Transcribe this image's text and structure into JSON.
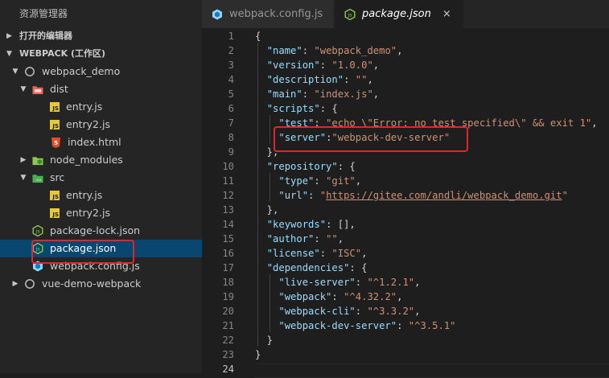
{
  "sidebar": {
    "title": "资源管理器",
    "sections": [
      {
        "label": "打开的编辑器",
        "expanded": false
      },
      {
        "label": "WEBPACK (工作区)",
        "expanded": true
      }
    ],
    "tree": [
      {
        "label": "webpack_demo",
        "kind": "root",
        "expanded": true,
        "depth": 1
      },
      {
        "label": "dist",
        "kind": "folder-dist",
        "expanded": true,
        "depth": 2
      },
      {
        "label": "entry.js",
        "kind": "js",
        "depth": 3
      },
      {
        "label": "entry2.js",
        "kind": "js",
        "depth": 3
      },
      {
        "label": "index.html",
        "kind": "html",
        "depth": 3
      },
      {
        "label": "node_modules",
        "kind": "folder-node",
        "expanded": false,
        "depth": 2
      },
      {
        "label": "src",
        "kind": "folder-src",
        "expanded": true,
        "depth": 2
      },
      {
        "label": "entry.js",
        "kind": "js",
        "depth": 3
      },
      {
        "label": "entry2.js",
        "kind": "js",
        "depth": 3
      },
      {
        "label": "package-lock.json",
        "kind": "node",
        "depth": 2
      },
      {
        "label": "package.json",
        "kind": "node",
        "depth": 2,
        "selected": true
      },
      {
        "label": "webpack.config.js",
        "kind": "webpack",
        "depth": 2
      },
      {
        "label": "vue-demo-webpack",
        "kind": "root",
        "expanded": false,
        "depth": 1
      }
    ]
  },
  "tabs": [
    {
      "label": "webpack.config.js",
      "active": false
    },
    {
      "label": "package.json",
      "active": true,
      "close": "×"
    }
  ],
  "js_badge": "JS",
  "editor": {
    "lines": [
      {
        "n": "1",
        "tokens": [
          [
            "punc",
            "{"
          ]
        ]
      },
      {
        "n": "2",
        "tokens": [
          [
            "punc",
            "  "
          ],
          [
            "key",
            "\"name\""
          ],
          [
            "punc",
            ": "
          ],
          [
            "str",
            "\"webpack_demo\""
          ],
          [
            "punc",
            ","
          ]
        ]
      },
      {
        "n": "3",
        "tokens": [
          [
            "punc",
            "  "
          ],
          [
            "key",
            "\"version\""
          ],
          [
            "punc",
            ": "
          ],
          [
            "str",
            "\"1.0.0\""
          ],
          [
            "punc",
            ","
          ]
        ]
      },
      {
        "n": "4",
        "tokens": [
          [
            "punc",
            "  "
          ],
          [
            "key",
            "\"description\""
          ],
          [
            "punc",
            ": "
          ],
          [
            "str",
            "\"\""
          ],
          [
            "punc",
            ","
          ]
        ]
      },
      {
        "n": "5",
        "tokens": [
          [
            "punc",
            "  "
          ],
          [
            "key",
            "\"main\""
          ],
          [
            "punc",
            ": "
          ],
          [
            "str",
            "\"index.js\""
          ],
          [
            "punc",
            ","
          ]
        ]
      },
      {
        "n": "6",
        "tokens": [
          [
            "punc",
            "  "
          ],
          [
            "key",
            "\"scripts\""
          ],
          [
            "punc",
            ": {"
          ]
        ]
      },
      {
        "n": "7",
        "tokens": [
          [
            "punc",
            "    "
          ],
          [
            "key",
            "\"test\""
          ],
          [
            "punc",
            ": "
          ],
          [
            "str",
            "\"echo \\\"Error: no test specified\\\" && exit 1\""
          ],
          [
            "punc",
            ","
          ]
        ]
      },
      {
        "n": "8",
        "tokens": [
          [
            "punc",
            "    "
          ],
          [
            "key",
            "\"server\""
          ],
          [
            "punc",
            ":"
          ],
          [
            "str",
            "\"webpack-dev-server\""
          ]
        ]
      },
      {
        "n": "9",
        "tokens": [
          [
            "punc",
            "  },"
          ]
        ]
      },
      {
        "n": "10",
        "tokens": [
          [
            "punc",
            "  "
          ],
          [
            "key",
            "\"repository\""
          ],
          [
            "punc",
            ": {"
          ]
        ]
      },
      {
        "n": "11",
        "tokens": [
          [
            "punc",
            "    "
          ],
          [
            "key",
            "\"type\""
          ],
          [
            "punc",
            ": "
          ],
          [
            "str",
            "\"git\""
          ],
          [
            "punc",
            ","
          ]
        ]
      },
      {
        "n": "12",
        "tokens": [
          [
            "punc",
            "    "
          ],
          [
            "key",
            "\"url\""
          ],
          [
            "punc",
            ": "
          ],
          [
            "str",
            "\""
          ],
          [
            "link",
            "https://gitee.com/andli/webpack_demo.git"
          ],
          [
            "str",
            "\""
          ]
        ]
      },
      {
        "n": "13",
        "tokens": [
          [
            "punc",
            "  },"
          ]
        ]
      },
      {
        "n": "14",
        "tokens": [
          [
            "punc",
            "  "
          ],
          [
            "key",
            "\"keywords\""
          ],
          [
            "punc",
            ": [],"
          ]
        ]
      },
      {
        "n": "15",
        "tokens": [
          [
            "punc",
            "  "
          ],
          [
            "key",
            "\"author\""
          ],
          [
            "punc",
            ": "
          ],
          [
            "str",
            "\"\""
          ],
          [
            "punc",
            ","
          ]
        ]
      },
      {
        "n": "16",
        "tokens": [
          [
            "punc",
            "  "
          ],
          [
            "key",
            "\"license\""
          ],
          [
            "punc",
            ": "
          ],
          [
            "str",
            "\"ISC\""
          ],
          [
            "punc",
            ","
          ]
        ]
      },
      {
        "n": "17",
        "tokens": [
          [
            "punc",
            "  "
          ],
          [
            "key",
            "\"dependencies\""
          ],
          [
            "punc",
            ": {"
          ]
        ]
      },
      {
        "n": "18",
        "tokens": [
          [
            "punc",
            "    "
          ],
          [
            "key",
            "\"live-server\""
          ],
          [
            "punc",
            ": "
          ],
          [
            "str",
            "\"^1.2.1\""
          ],
          [
            "punc",
            ","
          ]
        ]
      },
      {
        "n": "19",
        "tokens": [
          [
            "punc",
            "    "
          ],
          [
            "key",
            "\"webpack\""
          ],
          [
            "punc",
            ": "
          ],
          [
            "str",
            "\"^4.32.2\""
          ],
          [
            "punc",
            ","
          ]
        ]
      },
      {
        "n": "20",
        "tokens": [
          [
            "punc",
            "    "
          ],
          [
            "key",
            "\"webpack-cli\""
          ],
          [
            "punc",
            ": "
          ],
          [
            "str",
            "\"^3.3.2\""
          ],
          [
            "punc",
            ","
          ]
        ]
      },
      {
        "n": "21",
        "tokens": [
          [
            "punc",
            "    "
          ],
          [
            "key",
            "\"webpack-dev-server\""
          ],
          [
            "punc",
            ": "
          ],
          [
            "str",
            "\"^3.5.1\""
          ]
        ]
      },
      {
        "n": "22",
        "tokens": [
          [
            "punc",
            "  }"
          ]
        ]
      },
      {
        "n": "23",
        "tokens": [
          [
            "punc",
            "}"
          ]
        ]
      },
      {
        "n": "24",
        "tokens": [],
        "current": true
      }
    ]
  },
  "colors": {
    "highlight": "#e0262a",
    "selected_row": "#094771",
    "js_icon": "#e5c93a",
    "node_icon": "#8cc84b",
    "key": "#9cdcfe",
    "string": "#ce9178"
  }
}
